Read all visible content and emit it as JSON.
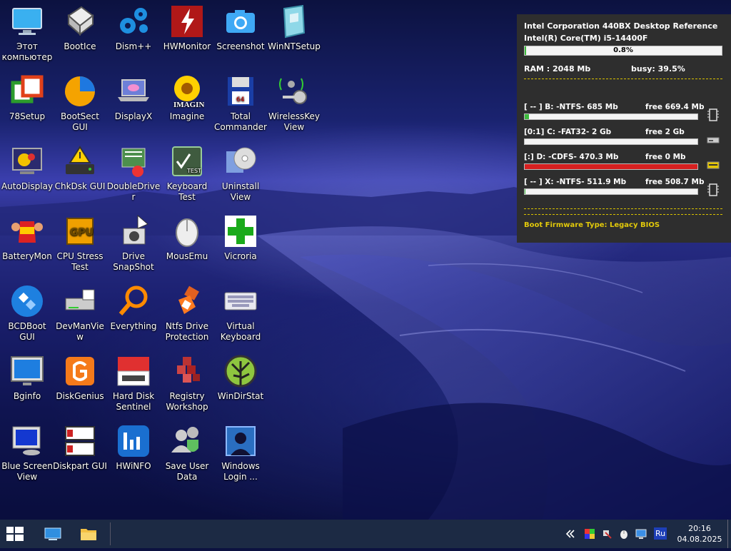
{
  "desktop": {
    "icons": [
      {
        "label": "Этот компьютер",
        "icon": "computer-icon"
      },
      {
        "label": "BootIce",
        "icon": "bootice-icon"
      },
      {
        "label": "Dism++",
        "icon": "gears-icon"
      },
      {
        "label": "HWMonitor",
        "icon": "hwmonitor-icon"
      },
      {
        "label": "Screenshot",
        "icon": "camera-icon"
      },
      {
        "label": "WinNTSetup",
        "icon": "winntsetup-icon"
      },
      {
        "label": "78Setup",
        "icon": "78setup-icon"
      },
      {
        "label": "BootSect GUI",
        "icon": "bootsect-icon"
      },
      {
        "label": "DisplayX",
        "icon": "laptop-icon"
      },
      {
        "label": "Imagine",
        "icon": "sunflower-icon"
      },
      {
        "label": "Total Commander",
        "icon": "floppy-icon"
      },
      {
        "label": "WirelessKey View",
        "icon": "wireless-key-icon"
      },
      {
        "label": "AutoDisplay",
        "icon": "paint-palette-icon"
      },
      {
        "label": "ChkDsk GUI",
        "icon": "warning-drive-icon"
      },
      {
        "label": "DoubleDriver",
        "icon": "driver-icon"
      },
      {
        "label": "Keyboard Test",
        "icon": "keyboard-test-icon"
      },
      {
        "label": "Uninstall View",
        "icon": "cd-icon"
      },
      {
        "label": "BatteryMon",
        "icon": "battery-icon"
      },
      {
        "label": "CPU Stress Test",
        "icon": "cpu-icon"
      },
      {
        "label": "Drive SnapShot",
        "icon": "snapshot-icon"
      },
      {
        "label": "MousEmu",
        "icon": "mouse-icon"
      },
      {
        "label": "Vicroria",
        "icon": "green-cross-icon"
      },
      {
        "label": "BCDBoot GUI",
        "icon": "bcdboot-icon"
      },
      {
        "label": "DevManView",
        "icon": "devman-icon"
      },
      {
        "label": "Everything",
        "icon": "magnifier-icon"
      },
      {
        "label": "Ntfs Drive Protection",
        "icon": "usb-shield-icon"
      },
      {
        "label": "Virtual Keyboard",
        "icon": "virtual-keyboard-icon"
      },
      {
        "label": "Bginfo",
        "icon": "monitor-icon"
      },
      {
        "label": "DiskGenius",
        "icon": "diskgenius-icon"
      },
      {
        "label": "Hard Disk Sentinel",
        "icon": "hdd-icon"
      },
      {
        "label": "Registry Workshop",
        "icon": "registry-cubes-icon"
      },
      {
        "label": "WinDirStat",
        "icon": "windirstat-icon"
      },
      {
        "label": "Blue Screen View",
        "icon": "bsod-monitor-icon"
      },
      {
        "label": "Diskpart GUI",
        "icon": "diskpart-icon"
      },
      {
        "label": "HWiNFO",
        "icon": "hwinfo-icon"
      },
      {
        "label": "Save User Data",
        "icon": "users-shield-icon"
      },
      {
        "label": "Windows Login ...",
        "icon": "login-icon"
      }
    ]
  },
  "sysinfo": {
    "board": "Intel Corporation 440BX Desktop Reference",
    "cpu": "Intel(R) Core(TM) i5-14400F",
    "cpu_load_text": "0.8%",
    "cpu_load": 0.008,
    "ram_text": "RAM : 2048 Mb",
    "busy_text": "busy: 39.5%",
    "drives": [
      {
        "left": "[ -- ]  B:  -NTFS-    685 Mb",
        "free": "free 669.4 Mb",
        "used": 0.023,
        "color": "#3dbb3d",
        "icon": "ram-chip-icon"
      },
      {
        "left": "[0:1]  C:  -FAT32-    2 Gb",
        "free": "free 2 Gb",
        "used": 0.0,
        "color": "#3dbb3d",
        "icon": "hdd-drive-icon"
      },
      {
        "left": "[:]  D:  -CDFS-    470.3 Mb",
        "free": "free 0 Mb",
        "used": 1.0,
        "color": "#d62020",
        "icon": "optical-drive-icon"
      },
      {
        "left": "[ -- ]  X:  -NTFS-    511.9 Mb",
        "free": "free 508.7 Mb",
        "used": 0.006,
        "color": "#3dbb3d",
        "icon": "ram-chip-icon"
      }
    ],
    "firmware": "Boot Firmware Type: Legacy BIOS"
  },
  "taskbar": {
    "start_icon": "windows-logo-icon",
    "pinned": [
      "desktop-icon",
      "file-explorer-icon"
    ],
    "tray": [
      "chevron-left-icon",
      "color-grid-icon",
      "tool-icon",
      "mouse-tray-icon",
      "monitor-tray-icon",
      "language-icon"
    ],
    "language": "Ru",
    "time": "20:16",
    "date": "04.08.2025"
  },
  "colors": {
    "taskbar": "#1c2a44",
    "panel": "#2e2e2e",
    "dash": "#d8c100",
    "firmware_text": "#e2c90a"
  }
}
